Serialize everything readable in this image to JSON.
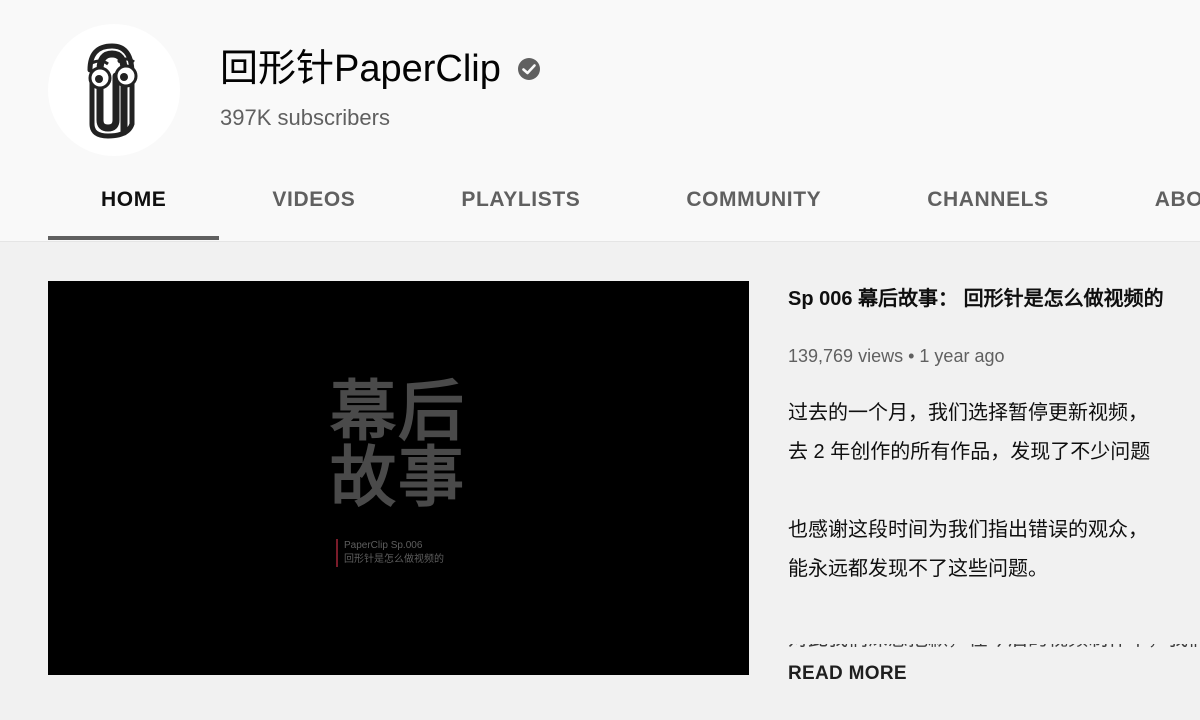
{
  "channel": {
    "name": "回形针PaperClip",
    "subscribers": "397K subscribers"
  },
  "tabs": [
    {
      "label": "HOME",
      "active": true
    },
    {
      "label": "VIDEOS"
    },
    {
      "label": "PLAYLISTS"
    },
    {
      "label": "COMMUNITY"
    },
    {
      "label": "CHANNELS"
    },
    {
      "label": "ABOUT"
    }
  ],
  "featured": {
    "poster": {
      "line1": "幕后",
      "line2": "故事",
      "caption1": "PaperClip Sp.006",
      "caption2": "回形针是怎么做视频的"
    },
    "title": "Sp 006 幕后故事： 回形针是怎么做视频的",
    "views": "139,769 views",
    "separator": "•",
    "age": "1 year ago",
    "description": [
      "过去的一个月，我们选择暂停更新视频，",
      "去 2 年创作的所有作品，发现了不少问题",
      "也感谢这段时间为我们指出错误的观众，",
      "能永远都发现不了这些问题。"
    ],
    "description_cut": "对此我们深感抱歉，在今后的视频制作中，我们",
    "read_more": "READ MORE"
  },
  "colors": {
    "page_bg": "#f1f1f1",
    "header_bg": "#f9f9f9",
    "active_tab_indicator": "#606060",
    "secondary_text": "#606060"
  }
}
